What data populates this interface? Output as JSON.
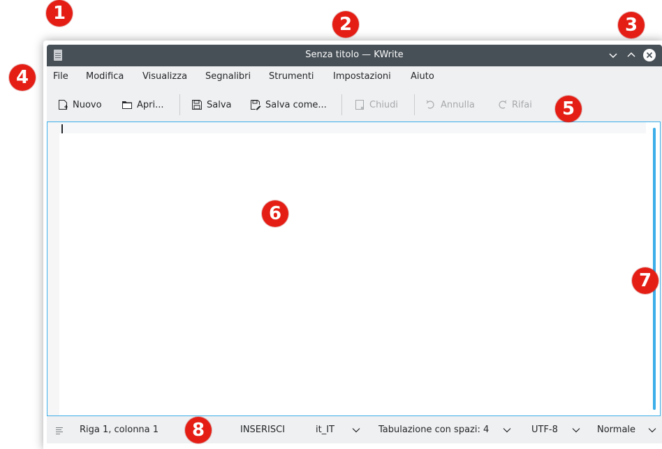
{
  "window": {
    "title": "Senza titolo — KWrite",
    "controls": [
      "chevron-down-icon",
      "chevron-up-icon",
      "close-icon"
    ]
  },
  "menubar": {
    "items": [
      {
        "label": "File"
      },
      {
        "label": "Modifica"
      },
      {
        "label": "Visualizza"
      },
      {
        "label": "Segnalibri"
      },
      {
        "label": "Strumenti"
      },
      {
        "label": "Impostazioni"
      },
      {
        "label": "Aiuto"
      }
    ]
  },
  "toolbar": {
    "new_label": "Nuovo",
    "open_label": "Apri...",
    "save_label": "Salva",
    "save_as_label": "Salva come...",
    "close_label": "Chiudi",
    "undo_label": "Annulla",
    "redo_label": "Rifai"
  },
  "editor": {
    "content": ""
  },
  "statusbar": {
    "cursor_position": "Riga 1, colonna 1",
    "input_mode": "INSERISCI",
    "dictionary": "it_IT",
    "indentation": "Tabulazione con spazi: 4",
    "encoding": "UTF-8",
    "mode": "Normale"
  },
  "callouts": [
    "1",
    "2",
    "3",
    "4",
    "5",
    "6",
    "7",
    "8"
  ],
  "colors": {
    "titlebar": "#475057",
    "accent": "#3daee9",
    "callout": "#e41e15",
    "background": "#eff0f1"
  }
}
